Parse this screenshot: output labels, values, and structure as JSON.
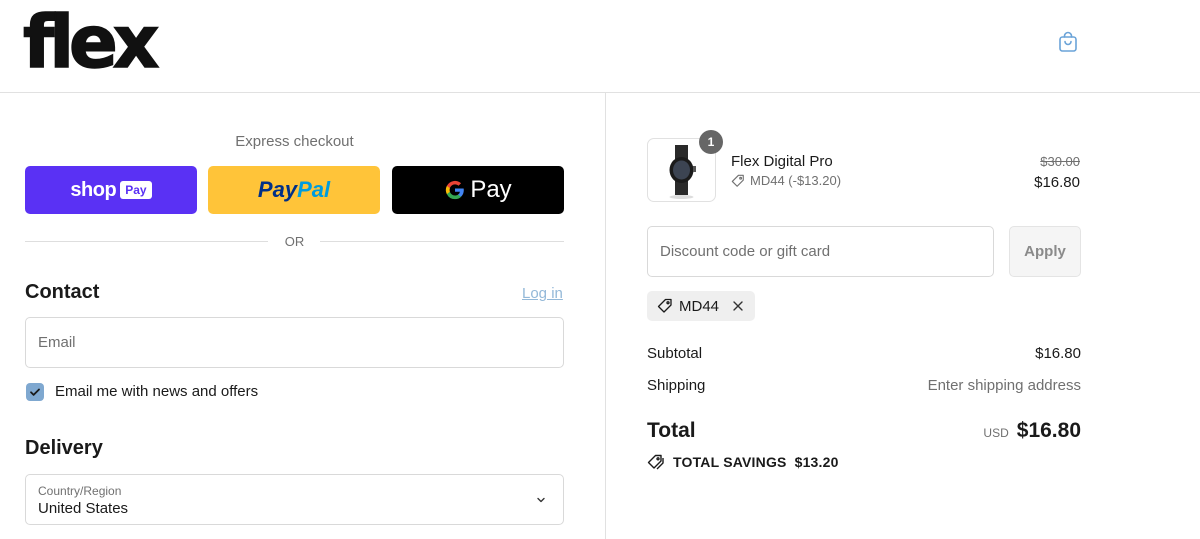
{
  "header": {
    "logo_text": "flex",
    "cart_icon": "shopping-bag-icon"
  },
  "express": {
    "label": "Express checkout",
    "shop_pay": {
      "word": "shop",
      "pill": "Pay"
    },
    "paypal": {
      "pay": "Pay",
      "pal": "Pal"
    },
    "gpay": {
      "g": "G",
      "word": "Pay"
    },
    "or_text": "OR"
  },
  "contact": {
    "title": "Contact",
    "login_link": "Log in",
    "email_placeholder": "Email",
    "newsletter_checked": true,
    "newsletter_label": "Email me with news and offers"
  },
  "delivery": {
    "title": "Delivery",
    "country_label": "Country/Region",
    "country_value": "United States"
  },
  "order": {
    "item": {
      "quantity": "1",
      "name": "Flex Digital Pro",
      "discount_note": "MD44 (-$13.20)",
      "original_price": "$30.00",
      "price": "$16.80"
    },
    "discount_placeholder": "Discount code or gift card",
    "apply_label": "Apply",
    "applied_code": "MD44",
    "subtotal_label": "Subtotal",
    "subtotal_value": "$16.80",
    "shipping_label": "Shipping",
    "shipping_value": "Enter shipping address",
    "total_label": "Total",
    "total_currency": "USD",
    "total_value": "$16.80",
    "savings_label": "TOTAL SAVINGS",
    "savings_value": "$13.20"
  },
  "colors": {
    "shop_pay": "#5a31f4",
    "paypal": "#ffc439",
    "gpay": "#000000",
    "link": "#93b8d8",
    "checkbox": "#7fa8d0"
  }
}
